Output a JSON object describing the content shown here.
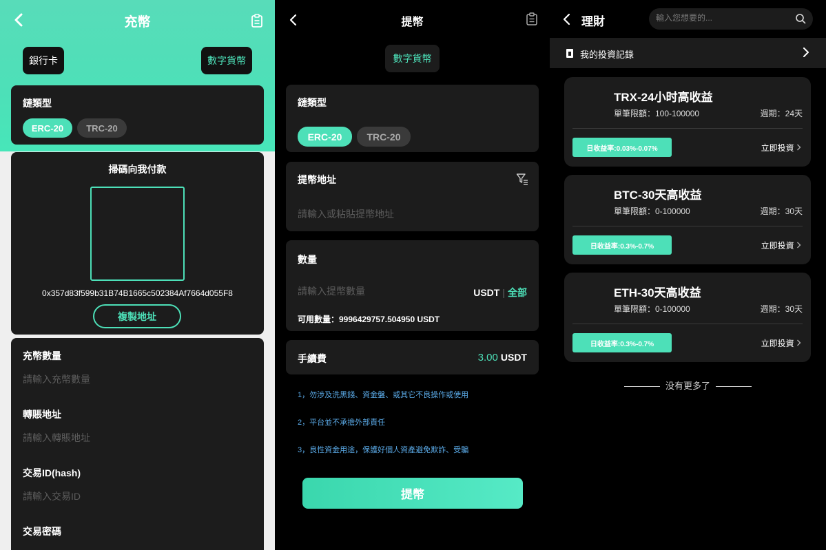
{
  "deposit": {
    "title": "充幣",
    "tabs": {
      "bank": "銀行卡",
      "crypto": "數字貨幣"
    },
    "chain": {
      "label": "鏈類型",
      "options": [
        "ERC-20",
        "TRC-20"
      ]
    },
    "qr": {
      "title": "掃碼向我付款",
      "address": "0x357d83f599b31B74B1665c502384Af7664d055F8",
      "copy_label": "複製地址"
    },
    "form": {
      "amount_label": "充幣數量",
      "amount_placeholder": "請輸入充幣數量",
      "from_label": "轉賬地址",
      "from_placeholder": "請輸入轉賬地址",
      "hash_label": "交易ID(hash)",
      "hash_placeholder": "請輸入交易ID",
      "password_label": "交易密碼"
    }
  },
  "withdraw": {
    "title": "提幣",
    "tab": "數字貨幣",
    "chain": {
      "label": "鏈類型",
      "options": [
        "ERC-20",
        "TRC-20"
      ]
    },
    "address": {
      "label": "提幣地址",
      "placeholder": "請輸入或粘貼提幣地址"
    },
    "amount": {
      "label": "數量",
      "placeholder": "請輸入提幣數量",
      "unit": "USDT",
      "all": "全部",
      "available": "可用數量：9996429757.504950 USDT"
    },
    "fee": {
      "label": "手續費",
      "value": "3.00",
      "unit": "USDT"
    },
    "notes": [
      "1，勿涉及洗黑錢、資金盤、或其它不良操作或使用",
      "2，平台並不承擔外部責任",
      "3，良性資金用途，保護好個人資產避免欺詐、受騙"
    ],
    "submit": "提幣"
  },
  "invest": {
    "title": "理財",
    "search_placeholder": "輸入您想要的...",
    "records_label": "我的投資記錄",
    "products": [
      {
        "name": "TRX-24小时高收益",
        "limit": "單筆限額：100-100000",
        "period": "週期：24天",
        "rate": "日收益率:0.03%-0.07%",
        "action": "立即投資"
      },
      {
        "name": "BTC-30天高收益",
        "limit": "單筆限額：0-100000",
        "period": "週期：30天",
        "rate": "日收益率:0.3%-0.7%",
        "action": "立即投資"
      },
      {
        "name": "ETH-30天高收益",
        "limit": "單筆限額：0-100000",
        "period": "週期：30天",
        "rate": "日收益率:0.3%-0.7%",
        "action": "立即投資"
      }
    ],
    "no_more": "没有更多了"
  },
  "colors": {
    "accent": "#4de0b8",
    "card": "#1c1c1c",
    "note": "#5aa9e6"
  }
}
